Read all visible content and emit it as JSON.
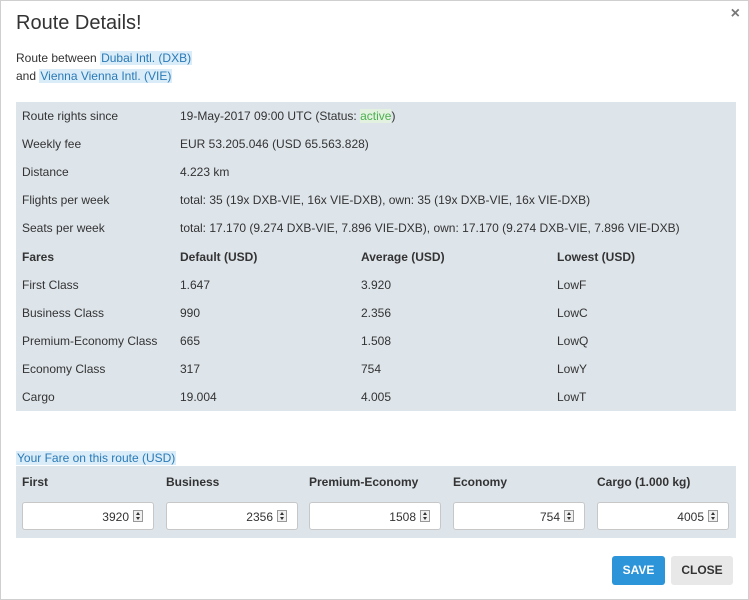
{
  "dialog": {
    "title": "Route Details!",
    "close_icon": "×"
  },
  "route": {
    "line1_prefix": "Route between ",
    "origin": "Dubai Intl. (DXB)",
    "line2_prefix": "and ",
    "destination": "Vienna Vienna Intl. (VIE)"
  },
  "info": {
    "rights_label": "Route rights since",
    "rights_value_prefix": "19-May-2017 09:00 UTC (Status: ",
    "rights_status": "active",
    "rights_value_suffix": ")",
    "fee_label": "Weekly fee",
    "fee_value": "EUR 53.205.046 (USD 65.563.828)",
    "distance_label": "Distance",
    "distance_value": "4.223 km",
    "flights_label": "Flights per week",
    "flights_value": "total: 35 (19x DXB-VIE, 16x VIE-DXB), own: 35 (19x DXB-VIE, 16x VIE-DXB)",
    "seats_label": "Seats per week",
    "seats_value": "total: 17.170 (9.274 DXB-VIE, 7.896 VIE-DXB), own: 17.170 (9.274 DXB-VIE, 7.896 VIE-DXB)"
  },
  "fares_table": {
    "headers": [
      "Fares",
      "Default (USD)",
      "Average (USD)",
      "Lowest (USD)"
    ],
    "rows": [
      [
        "First Class",
        "1.647",
        "3.920",
        "LowF"
      ],
      [
        "Business Class",
        "990",
        "2.356",
        "LowC"
      ],
      [
        "Premium-Economy Class",
        "665",
        "1.508",
        "LowQ"
      ],
      [
        "Economy Class",
        "317",
        "754",
        "LowY"
      ],
      [
        "Cargo",
        "19.004",
        "4.005",
        "LowT"
      ]
    ]
  },
  "your_fare": {
    "heading": "Your Fare on this route (USD)",
    "fields": [
      {
        "label": "First",
        "value": "3920"
      },
      {
        "label": "Business",
        "value": "2356"
      },
      {
        "label": "Premium-Economy",
        "value": "1508"
      },
      {
        "label": "Economy",
        "value": "754"
      },
      {
        "label": "Cargo (1.000 kg)",
        "value": "4005"
      }
    ]
  },
  "buttons": {
    "save": "SAVE",
    "close": "CLOSE"
  },
  "colors": {
    "accent": "#2c94d8",
    "panel": "#dde4ea",
    "status_active": "#4caf50"
  }
}
